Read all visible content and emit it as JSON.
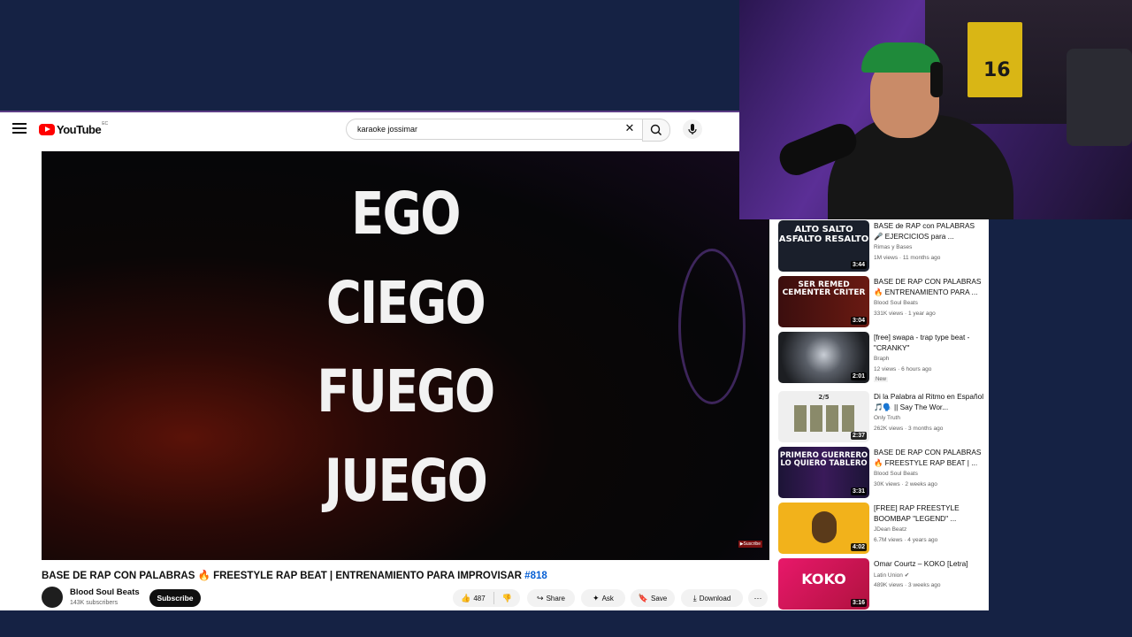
{
  "app": {
    "name": "YouTube",
    "country_code": "EC"
  },
  "search": {
    "value": "karaoke jossimar"
  },
  "video": {
    "overlay_words": [
      "EGO",
      "CIEGO",
      "FUEGO",
      "JUEGO"
    ],
    "title_text": "BASE DE RAP CON PALABRAS 🔥 FREESTYLE RAP BEAT | ENTRENAMIENTO PARA IMPROVISAR",
    "hashtag": "#818",
    "corner_badge": "▶Suscribe"
  },
  "channel": {
    "name": "Blood Soul Beats",
    "subscribers": "143K subscribers",
    "subscribe_label": "Subscribe"
  },
  "actions": {
    "likes": "487",
    "share": "Share",
    "ask": "Ask",
    "save": "Save",
    "download": "Download"
  },
  "recommendations": [
    {
      "thumb_text": "ALTO SALTO ASFALTO RESALTO",
      "title": "BASE de RAP con PALABRAS 🎤 EJERCICIOS para ...",
      "channel": "Rimas y Bases",
      "meta": "1M views · 11 months ago",
      "duration": "3:44",
      "thumb_color": "#1a1f2b"
    },
    {
      "thumb_text": "SER REMED CEMENTER CRITER",
      "title": "BASE DE RAP CON PALABRAS 🔥 ENTRENAMIENTO PARA ...",
      "channel": "Blood Soul Beats",
      "meta": "331K views · 1 year ago",
      "duration": "3:04",
      "thumb_color": "#3b0e0e"
    },
    {
      "thumb_text": "",
      "title": "[free] swapa - trap type beat - \"CRANKY\"",
      "channel": "Braph",
      "meta": "12 views · 6 hours ago",
      "duration": "2:01",
      "thumb_color": "#2a2d33",
      "badge": "New"
    },
    {
      "thumb_text": "2/5",
      "title": "Di la Palabra al Ritmo en Español 🎵🗣️ || Say The Wor...",
      "channel": "Only Truth",
      "meta": "262K views · 3 months ago",
      "duration": "2:37",
      "thumb_color": "#efefef"
    },
    {
      "thumb_text": "PRIMERO GUERRERO LO QUIERO TABLERO",
      "title": "BASE DE RAP CON PALABRAS 🔥 FREESTYLE RAP BEAT | ...",
      "channel": "Blood Soul Beats",
      "meta": "30K views · 2 weeks ago",
      "duration": "3:31",
      "thumb_color": "#1c1436"
    },
    {
      "thumb_text": "",
      "title": "[FREE] RAP FREESTYLE BOOMBAP \"LEGEND\" ...",
      "channel": "JDean Beatz",
      "meta": "6.7M views · 4 years ago",
      "duration": "4:02",
      "thumb_color": "#f2b21b"
    },
    {
      "thumb_text": "KOKO",
      "title": "Omar Courtz – KOKO [Letra]",
      "channel": "Latin Union ✔",
      "meta": "489K views · 3 weeks ago",
      "duration": "3:16",
      "thumb_color": "#d81b60"
    }
  ],
  "colors": {
    "accent": "#ff0000",
    "link": "#065fd4",
    "background": "#152244"
  }
}
